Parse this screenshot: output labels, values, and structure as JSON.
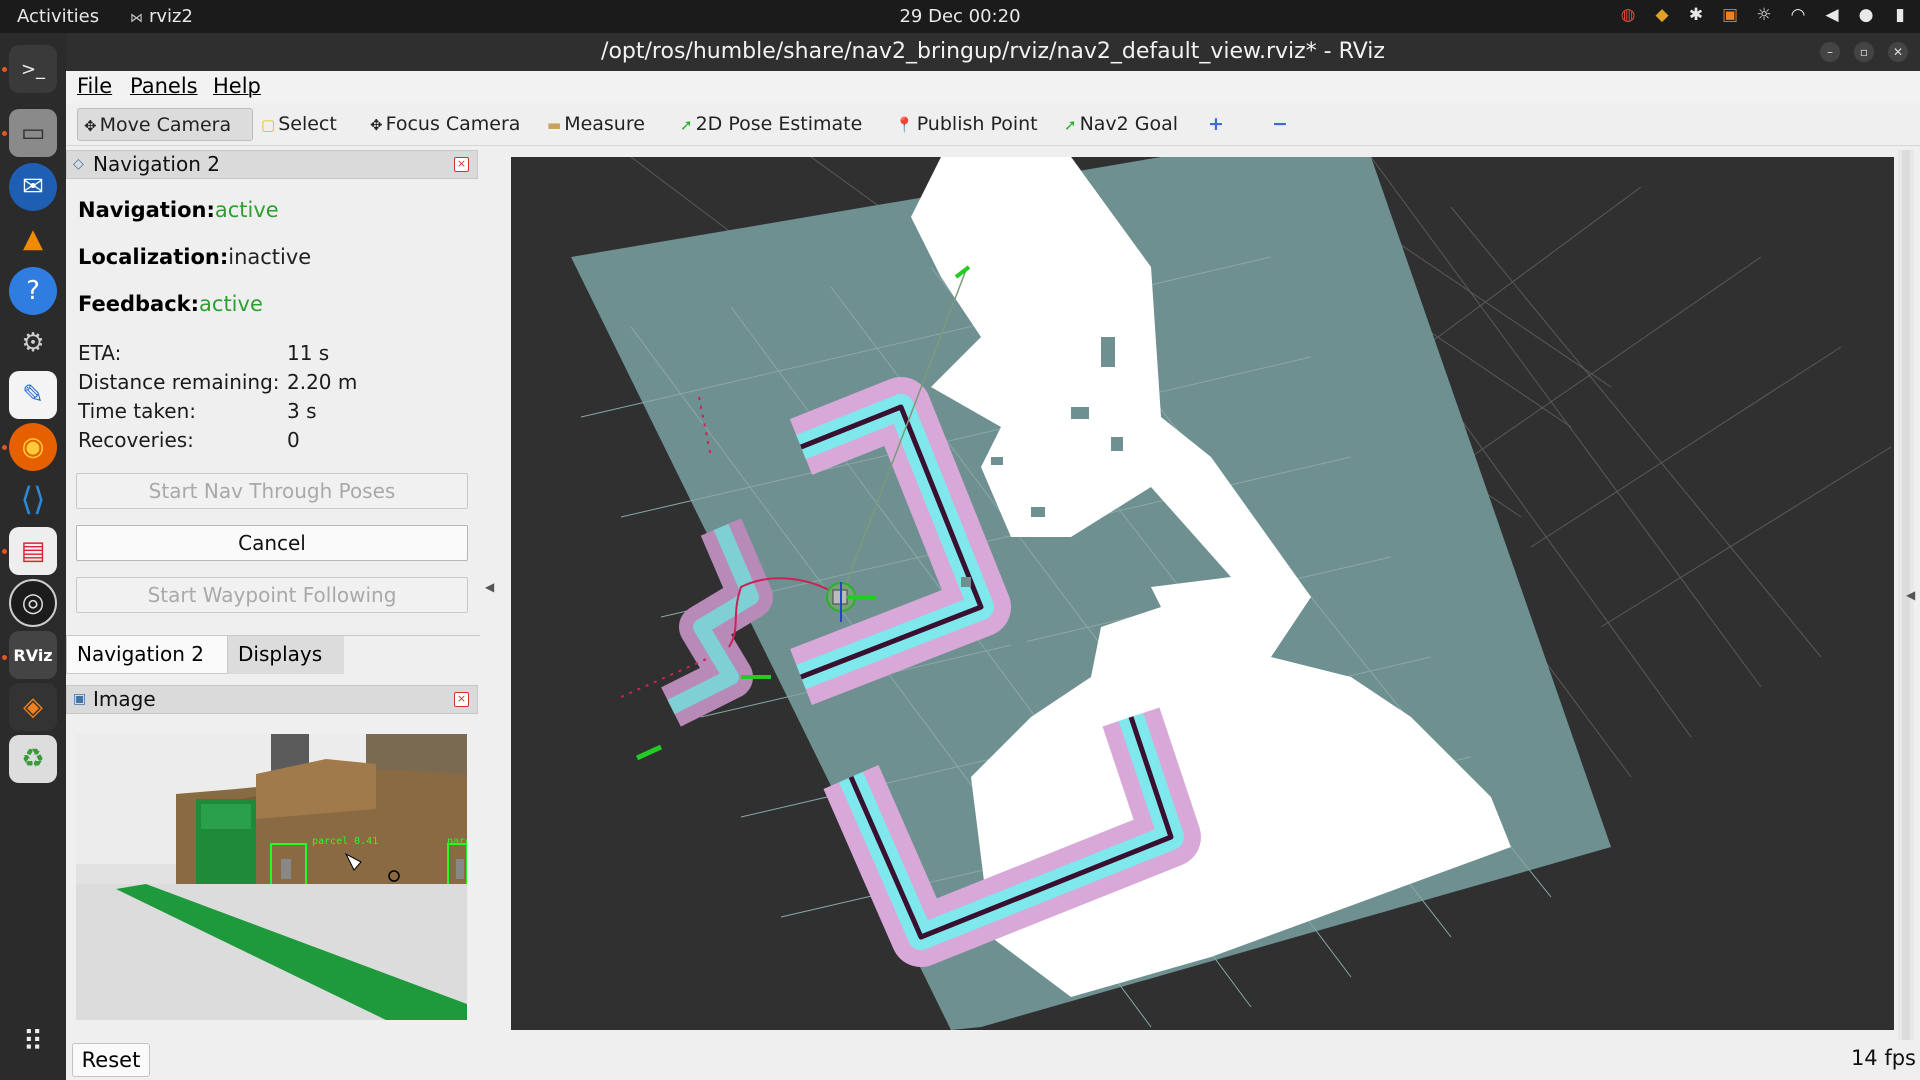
{
  "topbar": {
    "activities": "Activities",
    "app_name": "rviz2",
    "clock": "29 Dec  00:20",
    "tray_icons": [
      "chrome-icon",
      "vpn-icon",
      "accessibility-icon",
      "screen-share-icon",
      "brightness-icon",
      "wifi-icon",
      "volume-icon",
      "microphone-icon",
      "battery-icon"
    ]
  },
  "dock": {
    "items": [
      "terminal-icon",
      "files-icon",
      "thunderbird-icon",
      "vlc-icon",
      "help-icon",
      "settings-icon",
      "text-editor-icon",
      "firefox-icon",
      "vscode-icon",
      "document-viewer-icon",
      "obs-icon",
      "rviz-icon",
      "sublime-icon",
      "trash-icon",
      "show-apps-icon"
    ],
    "rviz_label": "RViz"
  },
  "window": {
    "title": "/opt/ros/humble/share/nav2_bringup/rviz/nav2_default_view.rviz* - RViz"
  },
  "menu": {
    "file": "File",
    "panels": "Panels",
    "help": "Help"
  },
  "toolbar": {
    "move_camera": "Move Camera",
    "select": "Select",
    "focus_camera": "Focus Camera",
    "measure": "Measure",
    "pose_estimate": "2D Pose Estimate",
    "publish_point": "Publish Point",
    "nav2_goal": "Nav2 Goal",
    "add_tool": "+",
    "remove_tool": "−"
  },
  "nav_panel": {
    "title": "Navigation 2",
    "navigation_label": "Navigation:",
    "navigation_value": "active",
    "localization_label": "Localization:",
    "localization_value": "inactive",
    "feedback_label": "Feedback:",
    "feedback_value": "active",
    "eta_label": "ETA:",
    "eta_value": "11 s",
    "distance_label": "Distance remaining:",
    "distance_value": "2.20 m",
    "time_label": "Time taken:",
    "time_value": "3 s",
    "recoveries_label": "Recoveries:",
    "recoveries_value": "0",
    "start_nav_poses": "Start Nav Through Poses",
    "cancel": "Cancel",
    "start_waypoint": "Start Waypoint Following"
  },
  "tabs": {
    "navigation": "Navigation 2",
    "displays": "Displays"
  },
  "image_panel": {
    "title": "Image",
    "labels": [
      "parcel 0.41",
      "parc"
    ]
  },
  "bottom": {
    "reset": "Reset",
    "fps": "14 fps"
  },
  "colors": {
    "status_green": "#2e9e33",
    "viewport_bg": "#303030",
    "map_unknown": "#6f9090",
    "map_free": "#ffffff",
    "costmap_cyan": "#7fe8ec",
    "costmap_pink": "#d8a8d8",
    "goal_green": "#22cc22",
    "ubuntu_orange": "#e95420"
  }
}
